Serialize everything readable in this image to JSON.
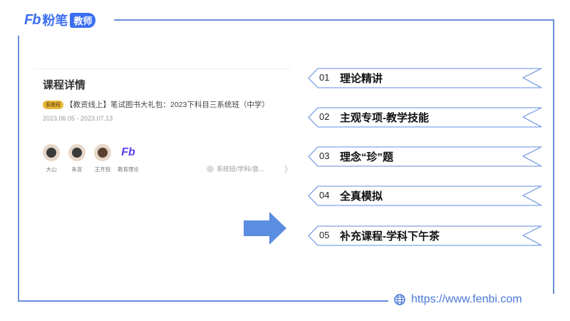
{
  "logo": {
    "mark": "Fb",
    "name": "粉笔",
    "badge": "教师"
  },
  "card": {
    "title": "课程详情",
    "tag": "系统班",
    "course_name": "【教资线上】笔试图书大礼包：2023下科目三系统班（中学）",
    "dates": "2023.06.05 - 2023.07.13",
    "teachers": [
      {
        "name": "大山"
      },
      {
        "name": "朱宫"
      },
      {
        "name": "王齐悦"
      },
      {
        "name": "教育理论"
      }
    ],
    "category_link": "系统班/学科/音...",
    "chevron": "〉"
  },
  "banners": [
    {
      "num": "01",
      "label": "理论精讲"
    },
    {
      "num": "02",
      "label": "主观专项-教学技能"
    },
    {
      "num": "03",
      "label": "理念“珍”题"
    },
    {
      "num": "04",
      "label": "全真模拟"
    },
    {
      "num": "05",
      "label": "补充课程-学科下午茶"
    }
  ],
  "footer": {
    "url": "https://www.fenbi.com"
  },
  "colors": {
    "brand": "#3b6ef0",
    "line": "#6b8fdc",
    "arrow": "#5b8de0"
  }
}
